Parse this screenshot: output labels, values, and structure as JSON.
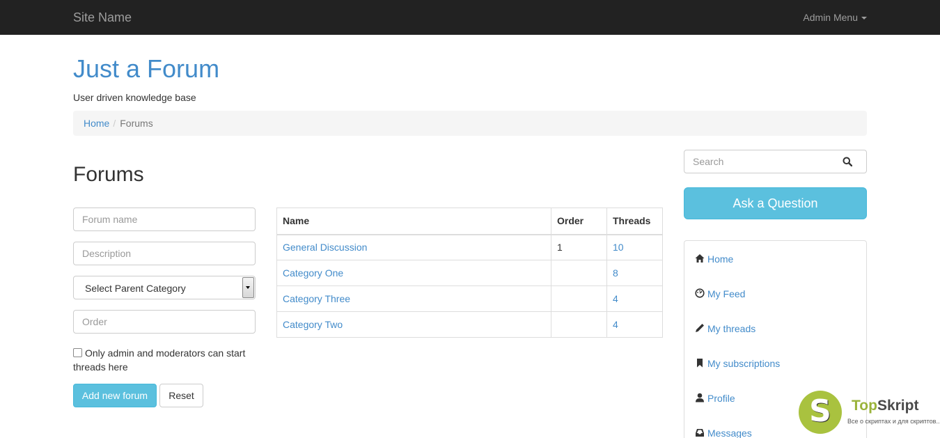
{
  "navbar": {
    "brand": "Site Name",
    "admin_menu": "Admin Menu"
  },
  "header": {
    "title": "Just a Forum",
    "tagline": "User driven knowledge base"
  },
  "breadcrumb": {
    "home": "Home",
    "current": "Forums"
  },
  "page": {
    "heading": "Forums"
  },
  "form": {
    "forum_name_placeholder": "Forum name",
    "description_placeholder": "Description",
    "parent_category": "Select Parent Category",
    "order_placeholder": "Order",
    "checkbox_label": "Only admin and moderators can start threads here",
    "add_button": "Add new forum",
    "reset_button": "Reset"
  },
  "table": {
    "headers": [
      "Name",
      "Order",
      "Threads"
    ],
    "rows": [
      {
        "name": "General Discussion",
        "order": "1",
        "threads": "10"
      },
      {
        "name": "Category One",
        "order": "",
        "threads": "8"
      },
      {
        "name": "Category Three",
        "order": "",
        "threads": "4"
      },
      {
        "name": "Category Two",
        "order": "",
        "threads": "4"
      }
    ]
  },
  "sidebar": {
    "search_placeholder": "Search",
    "ask_button": "Ask a Question",
    "items": [
      {
        "label": "Home",
        "icon": "home-icon"
      },
      {
        "label": "My Feed",
        "icon": "dashboard-icon"
      },
      {
        "label": "My threads",
        "icon": "pencil-icon"
      },
      {
        "label": "My subscriptions",
        "icon": "bookmark-icon"
      },
      {
        "label": "Profile",
        "icon": "user-icon"
      },
      {
        "label": "Messages",
        "icon": "inbox-icon"
      }
    ]
  },
  "watermark": {
    "letter": "S",
    "name_part1": "Top",
    "name_part2": "Skript",
    "subtitle": "Все о скриптах и для скриптов..."
  },
  "colors": {
    "navbar_bg": "#222222",
    "link": "#428bca",
    "info_button": "#5bc0de",
    "breadcrumb_bg": "#f5f5f5",
    "watermark_green": "#a9c23f"
  }
}
